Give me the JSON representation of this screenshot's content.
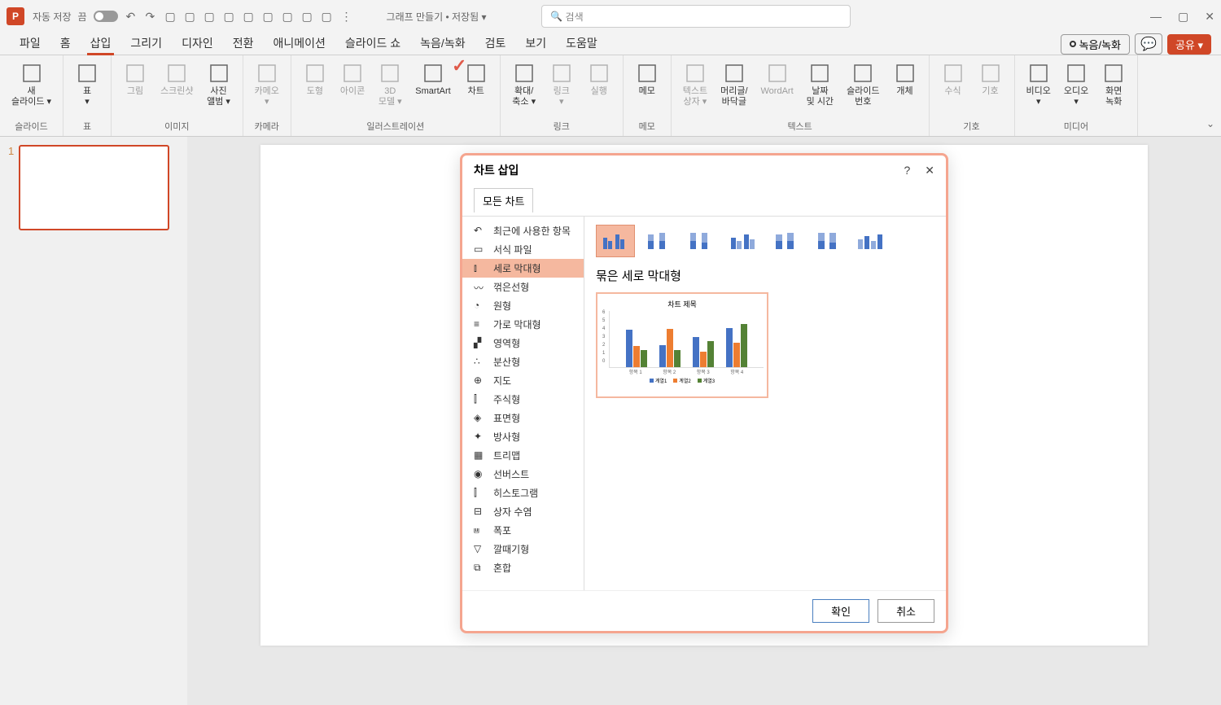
{
  "titlebar": {
    "autosave_label": "자동 저장",
    "autosave_off": "끔",
    "doc_title": "그래프 만들기 • 저장됨 ▾",
    "search_placeholder": "검색"
  },
  "tabs": {
    "items": [
      "파일",
      "홈",
      "삽입",
      "그리기",
      "디자인",
      "전환",
      "애니메이션",
      "슬라이드 쇼",
      "녹음/녹화",
      "검토",
      "보기",
      "도움말"
    ],
    "active_index": 2,
    "record_label": "녹음/녹화",
    "share_label": "공유 ▾"
  },
  "ribbon": {
    "groups": [
      {
        "label": "슬라이드",
        "items": [
          {
            "label": "새\n슬라이드 ▾"
          }
        ]
      },
      {
        "label": "표",
        "items": [
          {
            "label": "표\n▾"
          }
        ]
      },
      {
        "label": "이미지",
        "items": [
          {
            "label": "그림",
            "disabled": true
          },
          {
            "label": "스크린샷",
            "disabled": true
          },
          {
            "label": "사진\n앨범 ▾"
          }
        ]
      },
      {
        "label": "카메라",
        "items": [
          {
            "label": "카메오\n▾",
            "disabled": true
          }
        ]
      },
      {
        "label": "일러스트레이션",
        "items": [
          {
            "label": "도형",
            "disabled": true
          },
          {
            "label": "아이콘",
            "disabled": true
          },
          {
            "label": "3D\n모델 ▾",
            "disabled": true
          },
          {
            "label": "SmartArt"
          },
          {
            "label": "차트"
          }
        ]
      },
      {
        "label": "링크",
        "items": [
          {
            "label": "확대/\n축소 ▾"
          },
          {
            "label": "링크\n▾",
            "disabled": true
          },
          {
            "label": "실행",
            "disabled": true
          }
        ]
      },
      {
        "label": "메모",
        "items": [
          {
            "label": "메모"
          }
        ]
      },
      {
        "label": "텍스트",
        "items": [
          {
            "label": "텍스트\n상자 ▾",
            "disabled": true
          },
          {
            "label": "머리글/\n바닥글"
          },
          {
            "label": "WordArt",
            "disabled": true
          },
          {
            "label": "날짜\n및 시간"
          },
          {
            "label": "슬라이드\n번호"
          },
          {
            "label": "개체"
          }
        ]
      },
      {
        "label": "기호",
        "items": [
          {
            "label": "수식",
            "disabled": true
          },
          {
            "label": "기호",
            "disabled": true
          }
        ]
      },
      {
        "label": "미디어",
        "items": [
          {
            "label": "비디오\n▾"
          },
          {
            "label": "오디오\n▾"
          },
          {
            "label": "화면\n녹화"
          }
        ]
      }
    ]
  },
  "slide_panel": {
    "numbers": [
      "1"
    ]
  },
  "dialog": {
    "title": "차트 삽입",
    "tab": "모든 차트",
    "categories": [
      "최근에 사용한 항목",
      "서식 파일",
      "세로 막대형",
      "꺾은선형",
      "원형",
      "가로 막대형",
      "영역형",
      "분산형",
      "지도",
      "주식형",
      "표면형",
      "방사형",
      "트리맵",
      "선버스트",
      "히스토그램",
      "상자 수염",
      "폭포",
      "깔때기형",
      "혼합"
    ],
    "selected_category_index": 2,
    "subtype_title": "묶은 세로 막대형",
    "ok": "확인",
    "cancel": "취소"
  },
  "chart_data": {
    "type": "bar",
    "title": "차트 제목",
    "categories": [
      "항목 1",
      "항목 2",
      "항목 3",
      "항목 4"
    ],
    "series": [
      {
        "name": "계열1",
        "values": [
          4.3,
          2.5,
          3.5,
          4.5
        ],
        "color": "#4472c4"
      },
      {
        "name": "계열2",
        "values": [
          2.4,
          4.4,
          1.8,
          2.8
        ],
        "color": "#ed7d31"
      },
      {
        "name": "계열3",
        "values": [
          2.0,
          2.0,
          3.0,
          5.0
        ],
        "color": "#548235"
      }
    ],
    "ylim": [
      0,
      6
    ],
    "yticks": [
      0,
      1,
      2,
      3,
      4,
      5,
      6
    ]
  }
}
